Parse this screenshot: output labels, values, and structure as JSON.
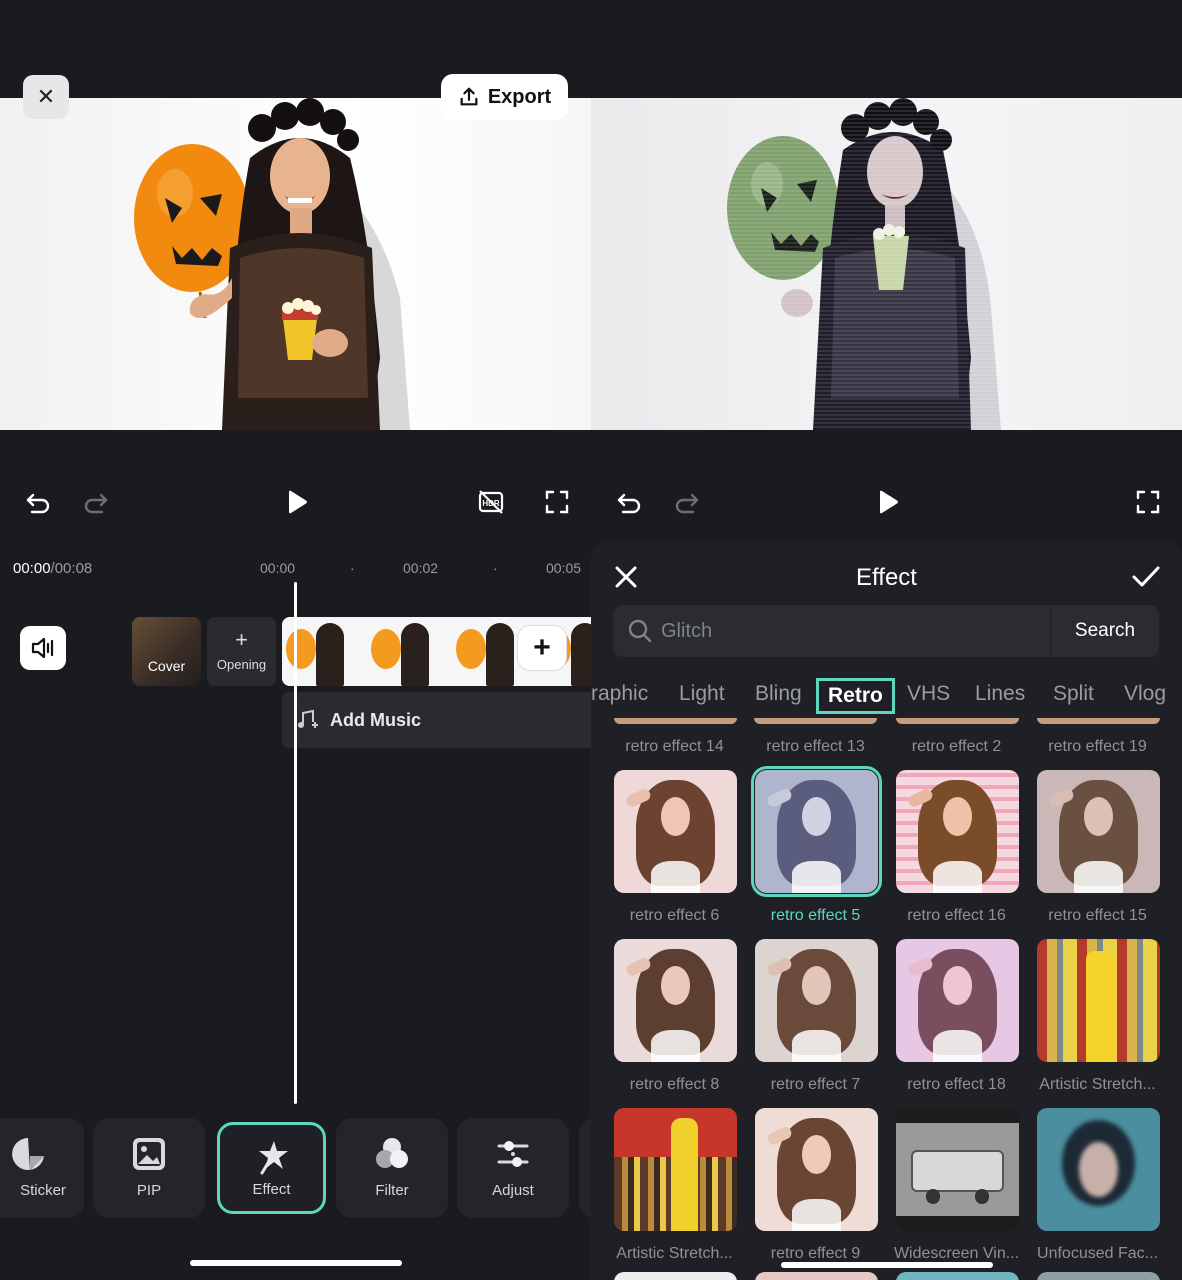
{
  "left": {
    "export_label": "Export",
    "timecode_current": "00:00",
    "timecode_total": "/00:08",
    "ruler": [
      "00:00",
      "·",
      "00:02",
      "·",
      "00:05"
    ],
    "cover_label": "Cover",
    "opening_label": "Opening",
    "add_music_label": "Add Music",
    "toolbar": [
      {
        "label": "Sticker",
        "icon": "sticker-icon"
      },
      {
        "label": "PIP",
        "icon": "pip-icon"
      },
      {
        "label": "Effect",
        "icon": "effect-icon",
        "active": true
      },
      {
        "label": "Filter",
        "icon": "filter-icon"
      },
      {
        "label": "Adjust",
        "icon": "adjust-icon"
      }
    ],
    "preview_image": "woman in black lace holding an orange jack-o'-lantern balloon and a popcorn cup on white background"
  },
  "right": {
    "preview_image": "same scene with a retro effect: desaturated cool tones, green balloon, scanline texture",
    "sheet": {
      "title": "Effect",
      "search_placeholder": "Glitch",
      "search_button": "Search",
      "categories": [
        "raphic",
        "Light",
        "Bling",
        "Retro",
        "VHS",
        "Lines",
        "Split",
        "Vlog"
      ],
      "active_category": "Retro",
      "effects_prev_row": [
        "retro effect 14",
        "retro effect 13",
        "retro effect 2",
        "retro effect 19"
      ],
      "effects_row1": [
        "retro effect 6",
        "retro effect 5",
        "retro effect 16",
        "retro effect 15"
      ],
      "effects_row2": [
        "retro effect 8",
        "retro effect 7",
        "retro effect 18",
        "Artistic Stretch..."
      ],
      "effects_row3": [
        "Artistic Stretch...",
        "retro effect 9",
        "Widescreen Vin...",
        "Unfocused Fac..."
      ],
      "selected_effect": "retro effect 5"
    }
  },
  "colors": {
    "accent": "#5dd6be",
    "background": "#1a1b1f",
    "sheet": "#1e2025"
  }
}
